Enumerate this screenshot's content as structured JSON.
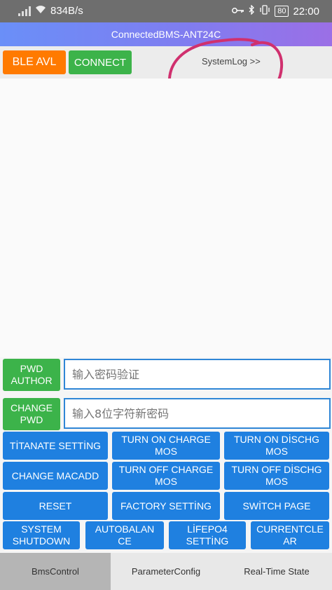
{
  "status_bar": {
    "speed": "834B/s",
    "battery": "80",
    "time": "22:00"
  },
  "title": "ConnectedBMS-ANT24C",
  "toolbar": {
    "ble_label": "BLE AVL",
    "connect_label": "CONNECT",
    "syslog_label": "SystemLog >>"
  },
  "auth": {
    "pwd_label": "PWD\nAUTHOR",
    "pwd_placeholder": "输入密码验证",
    "change_label": "CHANGE\nPWD",
    "change_placeholder": "输入8位字符新密码"
  },
  "controls": {
    "titanate": "TİTANATE SETTİNG",
    "turn_on_charge": "TURN ON CHARGE MOS",
    "turn_on_dischg": "TURN ON DİSCHG MOS",
    "change_macadd": "CHANGE MACADD",
    "turn_off_charge": "TURN OFF CHARGE MOS",
    "turn_off_dischg": "TURN OFF DİSCHG MOS",
    "reset": "RESET",
    "factory": "FACTORY SETTİNG",
    "switch_page": "SWİTCH PAGE",
    "shutdown": "SYSTEM SHUTDOWN",
    "autobalance": "AUTOBALANCE",
    "lifepo4": "LİFEPO4 SETTİNG",
    "currentclear": "CURRENTCLEAR"
  },
  "nav": {
    "tab1": "BmsControl",
    "tab2": "ParameterConfig",
    "tab3": "Real-Time State"
  },
  "colors": {
    "accent_blue": "#1f80e0",
    "green": "#3cb34a",
    "orange": "#ff7a00",
    "annotation": "#d0306e"
  }
}
